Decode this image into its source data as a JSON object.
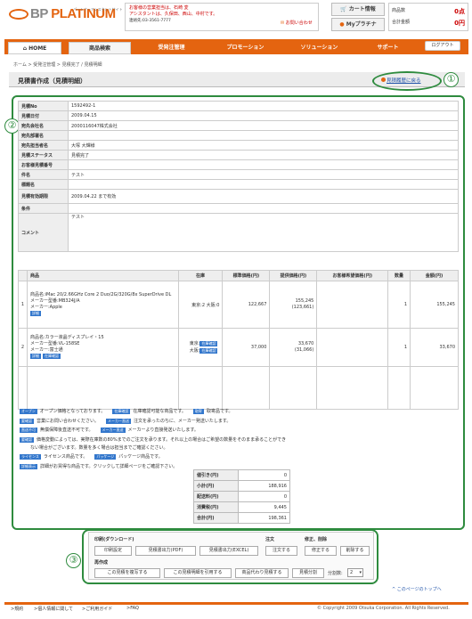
{
  "header": {
    "logo_text": "BP",
    "logo_text2": "PLATINUM",
    "logo_sub": "パートナーアシスタントサイト",
    "notice_line1": "お客様の営業担当は、石崎 変",
    "notice_line2": "アシスタントは、久保田、西山、中村です。",
    "notice_tel": "連絡先:03-3561-7777",
    "contact_label": "お問い合わせ",
    "cart_label": "カート情報",
    "mypl_label": "Myプラチナ",
    "cart_count_label": "商品数",
    "cart_count_value": "0点",
    "cart_total_label": "合計金額",
    "cart_total_value": "0円"
  },
  "nav": {
    "home": "HOME",
    "products": "商品検索",
    "orders": "受発注管理",
    "promotion": "プロモーション",
    "solution": "ソリューション",
    "support": "サポート",
    "logout": "ログアウト"
  },
  "breadcrumb": "ホーム > 受発注管理 > 見積完了 / 見積明細",
  "page": {
    "title": "見積書作成（見積明細）",
    "back_link": "見積履歴に戻る"
  },
  "callouts": [
    "①",
    "②",
    "③"
  ],
  "detail": [
    {
      "label": "見積No",
      "value": "1592492-1"
    },
    {
      "label": "見積日付",
      "value": "2009.04.15"
    },
    {
      "label": "宛先会社名",
      "value": "2000116047株式会社"
    },
    {
      "label": "宛先部署名",
      "value": ""
    },
    {
      "label": "宛先担当者名",
      "value": "大塚 大輝様"
    },
    {
      "label": "見積ステータス",
      "value": "見積完了"
    },
    {
      "label": "お客様見積番号",
      "value": ""
    },
    {
      "label": "件名",
      "value": "テスト"
    },
    {
      "label": "標題名",
      "value": ""
    },
    {
      "label": "見積有効期限",
      "value": "2009.04.22 まで有効"
    },
    {
      "label": "条件",
      "value": ""
    },
    {
      "label": "コメント",
      "value": "テスト"
    }
  ],
  "products": {
    "headers": [
      "商品",
      "在庫",
      "標準価格(円)",
      "提供価格(円)",
      "お客様希望価格(円)",
      "数量",
      "金額(円)"
    ],
    "rows": [
      {
        "no": "1",
        "name": "商品名:iMac 20/2.66GHz Core 2 Duo/2G/320G/8x SuperDrive DL",
        "model": "メーカー型番:MB324J/A",
        "maker": "メーカー:Apple",
        "tags": [
          "詳細"
        ],
        "stock": "東京:2 大阪:0",
        "std_price": "122,667",
        "offer_price": "155,245",
        "offer_price2": "(123,661)",
        "wish_price": "",
        "qty": "1",
        "amount": "155,245"
      },
      {
        "no": "2",
        "name": "商品名:カラー液晶ディスプレイ・15",
        "model": "メーカー型番:VL-158SE",
        "maker": "メーカー:富士通",
        "tags": [
          "詳細",
          "在庫確認"
        ],
        "stock": "東京:",
        "stock2": "大阪:",
        "stock_tags": [
          "在庫確認",
          "在庫確認"
        ],
        "std_price": "37,000",
        "offer_price": "33,670",
        "offer_price2": "(31,066)",
        "wish_price": "",
        "qty": "1",
        "amount": "33,670"
      }
    ]
  },
  "legend": [
    {
      "tag": "オープン",
      "text": "オープン価格となっております。",
      "tag2": "在庫確認",
      "text2": "在庫確認可能な商品です。",
      "tag3": "取寄",
      "text3": "取寄品です。"
    },
    {
      "tag": "要確認",
      "text": "営業にお問い合わせください。",
      "tag2": "メーカー直送",
      "text2": "注文を承ったのちに、メーカー発送いたします。"
    },
    {
      "tag": "直送不可",
      "text": "無償保障後直送不可です。",
      "tag2": "メーカー直送",
      "text2": "メーカーより直接発送いたします。"
    },
    {
      "tag": "要確認",
      "text": "価格変動によっては、実際在庫数の80%までのご注文を承ります。それ以上の場合はご希望の数量をそのまま承ることができ",
      "tag2": "",
      "text2": ""
    },
    {
      "tag": "",
      "text": "ない場合がございます。数量を多く場合は担当までご確認ください。",
      "tag2": "",
      "text2": ""
    },
    {
      "tag": "ライセンス",
      "text": "ライセンス商品です。",
      "tag2": "パッケージ",
      "text2": "パッケージ商品です。"
    },
    {
      "tag": "詳細表示",
      "text": "詳細がお買得な商品です。クリックして詳細ページをご確認下さい。",
      "tag2": "",
      "text2": ""
    }
  ],
  "totals": [
    {
      "label": "値引き(円)",
      "value": "0"
    },
    {
      "label": "小計(円)",
      "value": "188,916"
    },
    {
      "label": "配送料(円)",
      "value": "0"
    },
    {
      "label": "消費税(円)",
      "value": "9,445"
    },
    {
      "label": "合計(円)",
      "value": "198,361"
    }
  ],
  "actions": {
    "print_label": "印刷(ダウンロード)",
    "order_label": "注文",
    "edit_label": "修正、削除",
    "reorder_label": "再作成",
    "print_settings": "印刷設定",
    "print_pdf": "見積書出力(PDF)",
    "print_excel": "見積書出力(EXCEL)",
    "order": "注文する",
    "edit": "修正する",
    "delete": "削除する",
    "copy": "この見積を複写する",
    "quote": "この見積明細を引用する",
    "alt_quote": "商品代わり見積する",
    "split": "見積分割",
    "split_count_label": "分割数:",
    "split_count_value": "2"
  },
  "page_top": "このページのトップへ",
  "footer": {
    "terms": "規約",
    "privacy": "個人情報に関して",
    "guide": "ご利用ガイド",
    "faq": "FAQ",
    "copyright": "© Copyright 2009 Otsuka Corporation. All Rights Reserved."
  }
}
